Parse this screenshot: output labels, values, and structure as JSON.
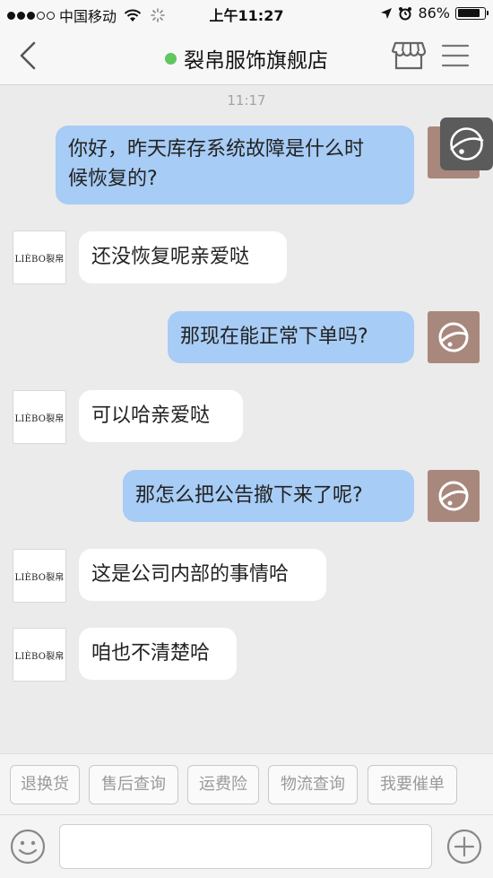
{
  "status_bar": {
    "carrier": "中国移动",
    "time": "上午11:27",
    "battery": "86%",
    "battery_level": 0.86,
    "signal_bars": 3,
    "icons": [
      "signal-dots-icon",
      "wifi-icon",
      "activity-spinner-icon",
      "location-arrow-icon",
      "alarm-clock-icon",
      "battery-icon"
    ]
  },
  "nav": {
    "title": "裂帛服饰旗舰店",
    "online_color": "#5fc75f",
    "icons": [
      "back-chevron-icon",
      "shop-icon",
      "menu-lines-icon"
    ]
  },
  "chat": {
    "timestamp": "11:17",
    "shop_avatar_text": "LIÈBO裂帛",
    "messages": [
      {
        "direction": "out",
        "text_line1": "你好，昨天库存系统故障是什么时",
        "text_line2": "候恢复的?"
      },
      {
        "direction": "in",
        "text": "还没恢复呢亲爱哒"
      },
      {
        "direction": "out",
        "text": "那现在能正常下单吗?"
      },
      {
        "direction": "in",
        "text": "可以哈亲爱哒"
      },
      {
        "direction": "out",
        "text": "那怎么把公告撤下来了呢?"
      },
      {
        "direction": "in",
        "text": "这是公司内部的事情哈"
      },
      {
        "direction": "in",
        "text": "咱也不清楚哈"
      }
    ],
    "colors": {
      "outgoing": "#a7ccf5",
      "incoming": "#ffffff",
      "background": "#ebebeb"
    }
  },
  "quick_replies": [
    "退换货",
    "售后查询",
    "运费险",
    "物流查询",
    "我要催单"
  ],
  "input": {
    "value": "",
    "icons": [
      "emoji-icon",
      "plus-icon"
    ]
  }
}
